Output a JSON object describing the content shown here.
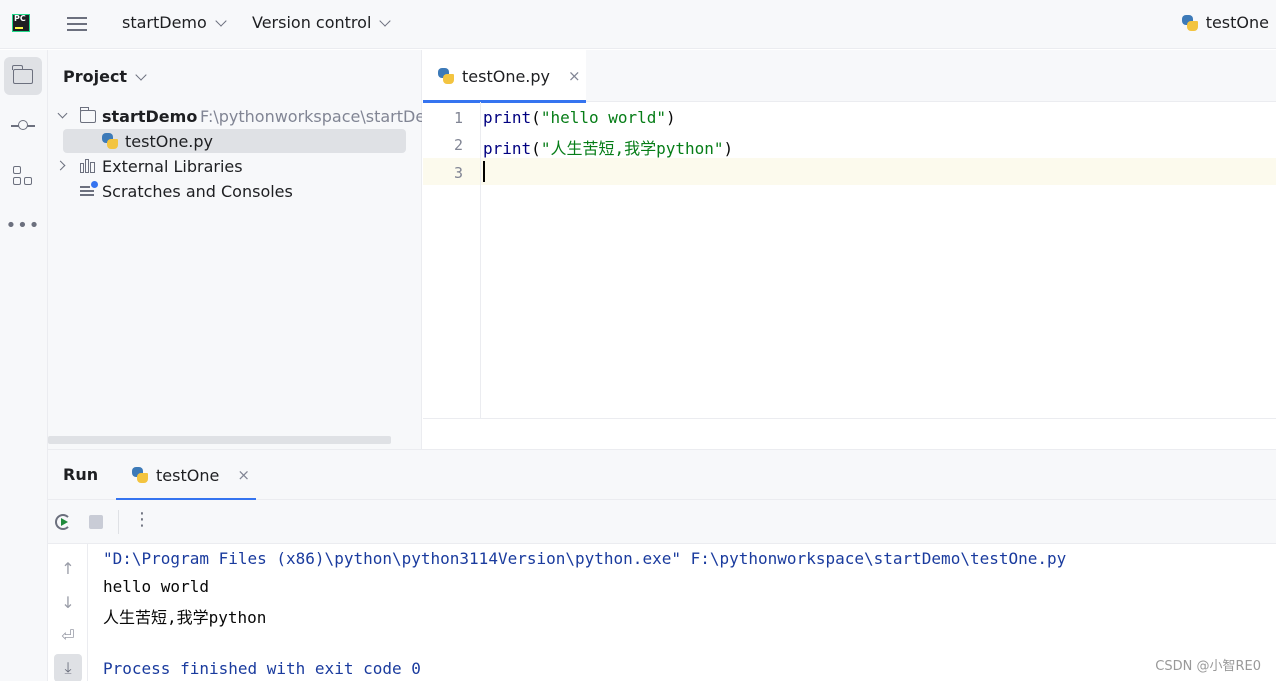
{
  "titlebar": {
    "project_name": "startDemo",
    "vcs_label": "Version control",
    "run_config": "testOne"
  },
  "project_panel": {
    "title": "Project",
    "root": {
      "name": "startDemo",
      "path": "F:\\pythonworkspace\\startDe"
    },
    "file": "testOne.py",
    "external": "External Libraries",
    "scratches": "Scratches and Consoles"
  },
  "editor": {
    "tab": "testOne.py",
    "close": "×",
    "line_numbers": [
      "1",
      "2",
      "3"
    ],
    "lines": [
      {
        "fn": "print",
        "open": "(",
        "str": "\"hello world\"",
        "close": ")"
      },
      {
        "fn": "print",
        "open": "(",
        "str": "\"人生苦短,我学python\"",
        "close": ")"
      }
    ]
  },
  "run_panel": {
    "title": "Run",
    "tab": "testOne",
    "close": "×",
    "more": "⋮",
    "output": [
      "\"D:\\Program Files (x86)\\python\\python3114Version\\python.exe\" F:\\pythonworkspace\\startDemo\\testOne.py",
      "hello world",
      "人生苦短,我学python",
      "",
      "Process finished with exit code 0"
    ]
  },
  "side_icons": {
    "up": "↑",
    "down": "↓",
    "wrap": "⏎",
    "scroll_end": "⤓"
  },
  "watermark": "CSDN @小智RE0"
}
